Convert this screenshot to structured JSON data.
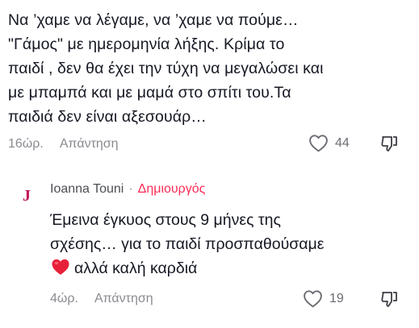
{
  "comment": {
    "text": "Να ’χαμε να λέγαμε, να ’χαμε να πούμε…\n\"Γάμος\" με ημερομηνία λήξης. Κρίμα το\nπαιδί , δεν θα έχει την τύχη να μεγαλώσει και\nμε μπαμπά και με μαμά στο σπίτι του.Τα\nπαιδιά δεν είναι αξεσουάρ…",
    "time": "16ώρ.",
    "reply_label": "Απάντηση",
    "like_count": "44"
  },
  "reply": {
    "avatar_letter": "J",
    "author": "Ioanna Touni",
    "separator": "·",
    "badge": "Δημιουργός",
    "text": "Έμεινα έγκυος στους 9 μήνες της\nσχέσης… για το παιδί προσπαθούσαμε",
    "text_tail": "αλλά καλή καρδιά",
    "time": "4ώρ.",
    "reply_label": "Απάντηση",
    "like_count": "19"
  },
  "colors": {
    "accent": "#fe2c55",
    "text": "#161823",
    "muted": "#8a8b91"
  },
  "icons": [
    "heart-outline-icon",
    "dislike-icon",
    "red-heart-emoji"
  ]
}
